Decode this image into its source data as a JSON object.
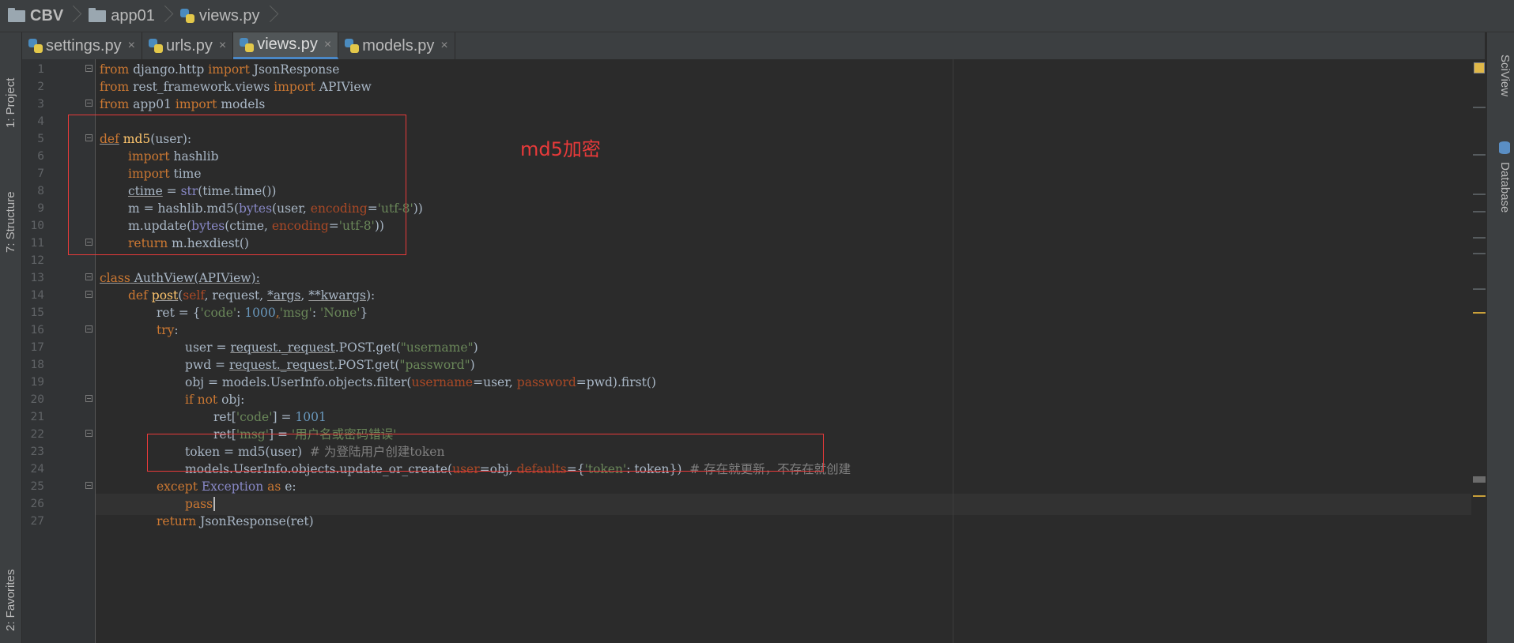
{
  "breadcrumb": {
    "project": "CBV",
    "folder": "app01",
    "file": "views.py"
  },
  "tabs": [
    {
      "label": "settings.py",
      "close": "×"
    },
    {
      "label": "urls.py",
      "close": "×"
    },
    {
      "label": "views.py",
      "close": "×"
    },
    {
      "label": "models.py",
      "close": "×"
    }
  ],
  "left_tools": {
    "project": "1: Project",
    "structure": "7: Structure",
    "favorites": "2: Favorites"
  },
  "right_tools": {
    "sciview": "SciView",
    "database": "Database"
  },
  "line_numbers": [
    "1",
    "2",
    "3",
    "4",
    "5",
    "6",
    "7",
    "8",
    "9",
    "10",
    "11",
    "12",
    "13",
    "14",
    "15",
    "16",
    "17",
    "18",
    "19",
    "20",
    "21",
    "22",
    "23",
    "24",
    "25",
    "26",
    "27"
  ],
  "annotation": "md5加密",
  "code": {
    "l1": {
      "t1": "from",
      "t2": " django.http ",
      "t3": "import",
      "t4": " JsonResponse"
    },
    "l2": {
      "t1": "from",
      "t2": " rest_framework.views ",
      "t3": "import",
      "t4": " APIView"
    },
    "l3": {
      "t1": "from",
      "t2": " app01 ",
      "t3": "import",
      "t4": " models"
    },
    "l5": {
      "t1": "def",
      "t2": " ",
      "t3": "md5",
      "t4": "(user):"
    },
    "l6": {
      "t1": "import",
      "t2": " hashlib"
    },
    "l7": {
      "t1": "import",
      "t2": " time"
    },
    "l8": {
      "t1": "ctime",
      "t2": " = ",
      "t3": "str",
      "t4": "(time.time())"
    },
    "l9": {
      "t1": "m = hashlib.md5(",
      "t2": "bytes",
      "t3": "(user, ",
      "t4": "encoding",
      "t5": "=",
      "t6": "'utf-8'",
      "t7": "))"
    },
    "l10": {
      "t1": "m.update(",
      "t2": "bytes",
      "t3": "(ctime, ",
      "t4": "encoding",
      "t5": "=",
      "t6": "'utf-8'",
      "t7": "))"
    },
    "l11": {
      "t1": "return",
      "t2": " m.hexdiest()"
    },
    "l13": {
      "t1": "class",
      "t2": " AuthView(APIView):"
    },
    "l14": {
      "t1": "def",
      "t2": " ",
      "t3": "post",
      "t4": "(",
      "t5": "self",
      "t6": ", request, ",
      "t7": "*args",
      "t8": ", ",
      "t9": "**kwargs",
      "t10": "):"
    },
    "l15": {
      "t1": "ret = {",
      "t2": "'code'",
      "t3": ": ",
      "t4": "1000",
      "t5": ",",
      "t6": "'msg'",
      "t7": ": ",
      "t8": "'None'",
      "t9": "}"
    },
    "l16": {
      "t1": "try",
      "t2": ":"
    },
    "l17": {
      "t1": "user = ",
      "t2": "request._request",
      "t3": ".POST.get(",
      "t4": "\"username\"",
      "t5": ")"
    },
    "l18": {
      "t1": "pwd = ",
      "t2": "request._request",
      "t3": ".POST.get(",
      "t4": "\"password\"",
      "t5": ")"
    },
    "l19": {
      "t1": "obj = models.UserInfo.objects.filter(",
      "t2": "username",
      "t3": "=user, ",
      "t4": "password",
      "t5": "=pwd).first()"
    },
    "l20": {
      "t1": "if not",
      "t2": " obj:"
    },
    "l21": {
      "t1": "ret[",
      "t2": "'code'",
      "t3": "] = ",
      "t4": "1001"
    },
    "l22": {
      "t1": "ret[",
      "t2": "'msg'",
      "t3": "] = ",
      "t4": "'用户名或密码错误'"
    },
    "l23": {
      "t1": "token = md5(user)  ",
      "t2": "# 为登陆用户创建token"
    },
    "l24": {
      "t1": "models.UserInfo.objects.update_or_create(",
      "t2": "user",
      "t3": "=obj, ",
      "t4": "defaults",
      "t5": "={",
      "t6": "'token'",
      "t7": ": token})  ",
      "t8": "# 存在就更新，不存在就创建"
    },
    "l25": {
      "t1": "except",
      "t2": " Exception ",
      "t3": "as",
      "t4": " e:"
    },
    "l26": {
      "t1": "pass"
    },
    "l27": {
      "t1": "return",
      "t2": " JsonResponse(ret)"
    }
  }
}
